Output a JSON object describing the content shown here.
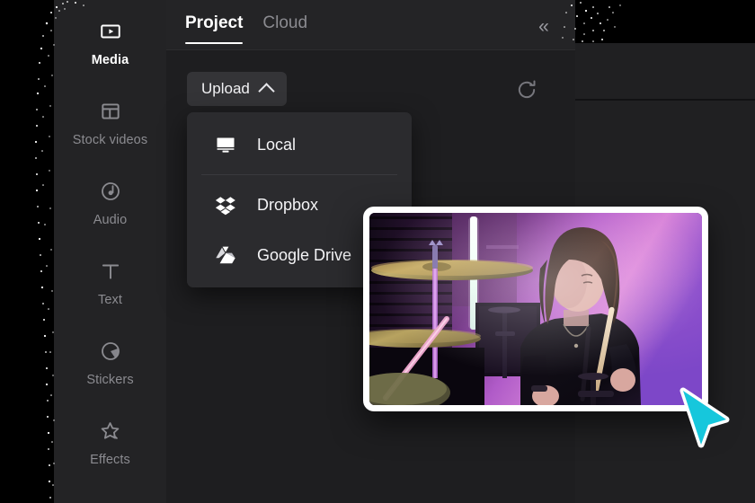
{
  "app": {
    "panel_title": "Media"
  },
  "sidebar": {
    "items": [
      {
        "label": "Media",
        "icon": "media-icon",
        "active": true
      },
      {
        "label": "Stock videos",
        "icon": "stock-videos-icon",
        "active": false
      },
      {
        "label": "Audio",
        "icon": "audio-icon",
        "active": false
      },
      {
        "label": "Text",
        "icon": "text-icon",
        "active": false
      },
      {
        "label": "Stickers",
        "icon": "stickers-icon",
        "active": false
      },
      {
        "label": "Effects",
        "icon": "effects-icon",
        "active": false
      }
    ]
  },
  "header": {
    "tabs": [
      {
        "label": "Project",
        "active": true
      },
      {
        "label": "Cloud",
        "active": false
      }
    ],
    "collapse_icon": "double-chevron-left-icon",
    "collapse_glyph": "«"
  },
  "toolbar": {
    "upload_label": "Upload",
    "upload_chevron_icon": "chevron-up-icon",
    "refresh_icon": "refresh-icon"
  },
  "upload_menu": {
    "items": [
      {
        "label": "Local",
        "icon": "monitor-icon"
      },
      {
        "label": "Dropbox",
        "icon": "dropbox-icon"
      },
      {
        "label": "Google Drive",
        "icon": "google-drive-icon"
      }
    ]
  },
  "media_card": {
    "name": "video-thumbnail",
    "description": "Drummer sitting behind a drum kit with cymbals, lit by purple and magenta studio lighting with a vertical white light tube"
  },
  "cursor": {
    "icon": "pointer-cursor",
    "color": "#16C7DC"
  },
  "colors": {
    "panel_bg": "#1e1e20",
    "sidebar_bg": "#232325",
    "header_bg": "#242426",
    "menu_bg": "#2b2b2e",
    "button_bg": "#343437",
    "text_primary": "#ffffff",
    "text_muted": "#8b8b90",
    "accent_cyan": "#16C7DC"
  }
}
